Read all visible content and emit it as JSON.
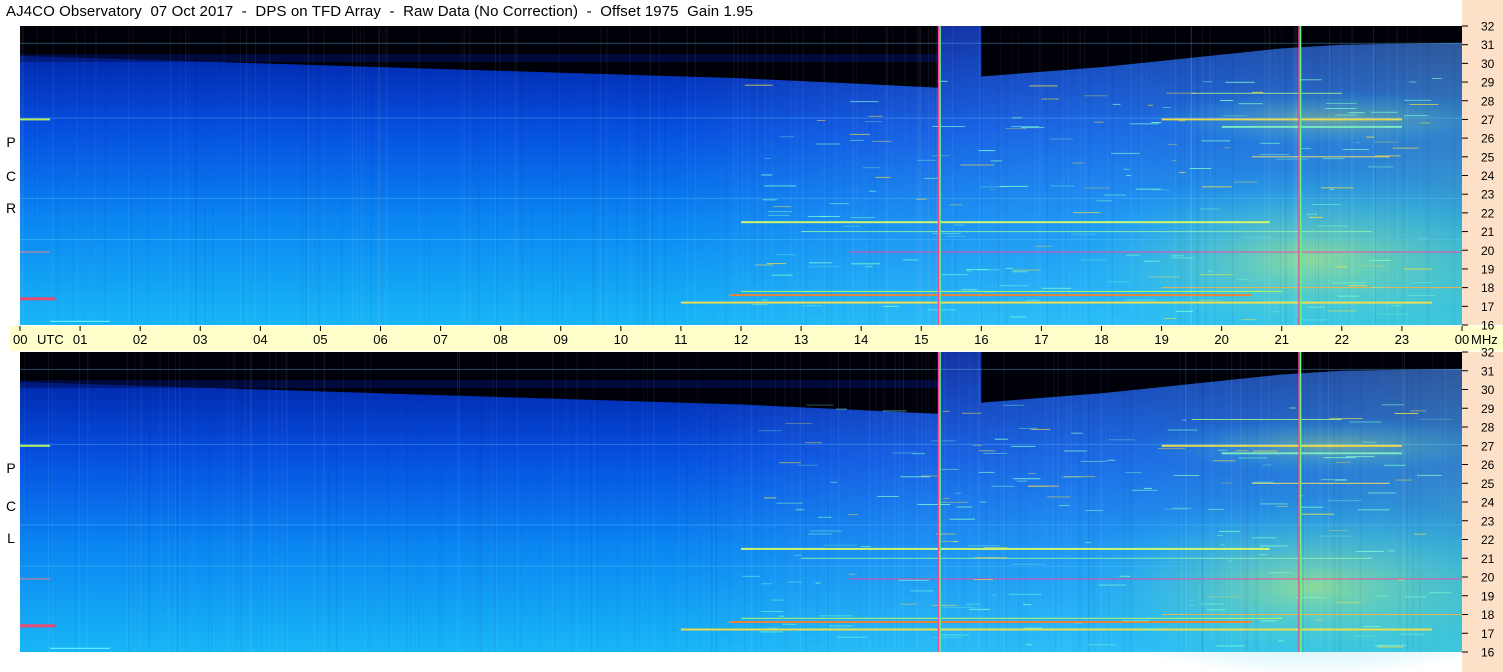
{
  "title": "AJ4CO Observatory  07 Oct 2017  -  DPS on TFD Array  -  Raw Data (No Correction)  -  Offset 1975  Gain 1.95",
  "colors": {
    "time_axis_band": "#ffffcc",
    "freq_axis_band": "#fde0c8",
    "background": "#ffffff",
    "colormap": [
      "#000010",
      "#00147a",
      "#003fd8",
      "#0a7cf0",
      "#10b8f5",
      "#50e0d0",
      "#c8ff50",
      "#ffe000",
      "#ff4000",
      "#ff00ff"
    ]
  },
  "chart_data": {
    "type": "heatmap",
    "x_axis": {
      "unit_label": "UTC",
      "tick_labels": [
        "00",
        "01",
        "02",
        "03",
        "04",
        "05",
        "06",
        "07",
        "08",
        "09",
        "10",
        "11",
        "12",
        "13",
        "14",
        "15",
        "16",
        "17",
        "18",
        "19",
        "20",
        "21",
        "22",
        "23",
        "00"
      ],
      "range_hours": [
        0,
        24
      ]
    },
    "y_axis": {
      "unit_label": "MHz",
      "tick_labels": [
        "16",
        "17",
        "18",
        "19",
        "20",
        "21",
        "22",
        "23",
        "24",
        "25",
        "26",
        "27",
        "28",
        "29",
        "30",
        "31",
        "32"
      ],
      "range_mhz": [
        16,
        32
      ]
    },
    "panels": [
      {
        "name": "RCP",
        "label_letters": [
          "R",
          "C",
          "P"
        ]
      },
      {
        "name": "LCP",
        "label_letters": [
          "L",
          "C",
          "P"
        ]
      }
    ],
    "features": {
      "vertical_lines_utc": [
        15.3,
        21.3
      ],
      "night_boundary_note": "dark region above ~30 MHz before ~15 UTC",
      "interference_freqs_mhz": [
        17.2,
        17.6,
        19.9,
        21.5,
        27.0
      ]
    }
  }
}
